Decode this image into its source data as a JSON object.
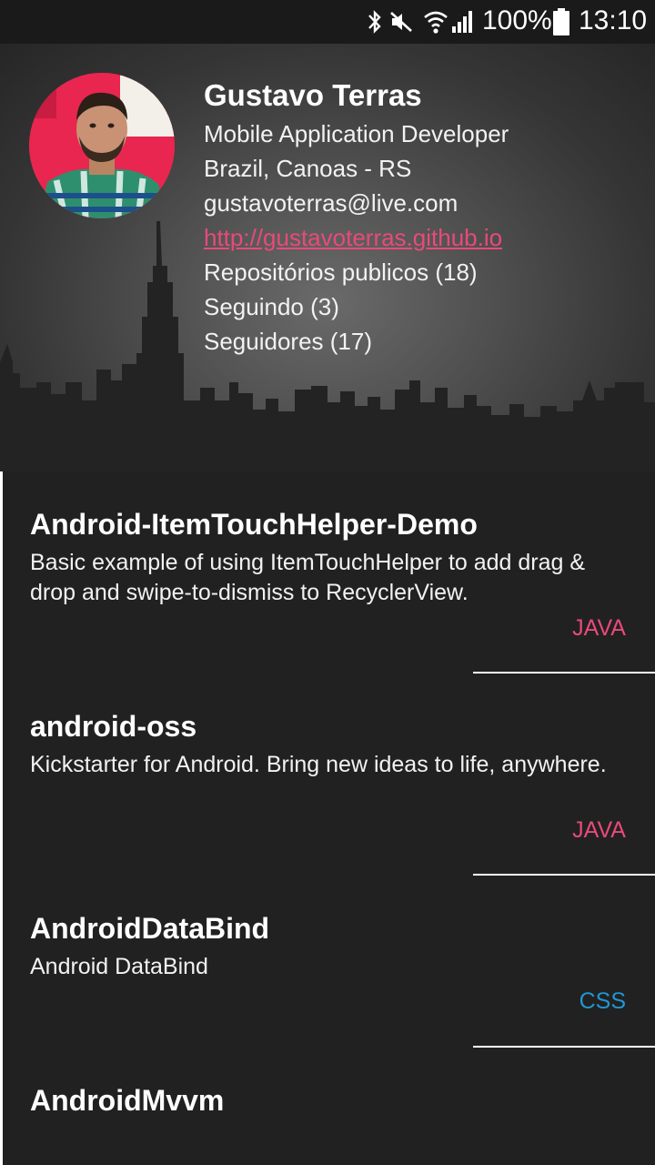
{
  "status_bar": {
    "battery": "100%",
    "time": "13:10",
    "icons": [
      "bluetooth-icon",
      "mute-icon",
      "wifi-icon",
      "signal-icon",
      "battery-icon"
    ]
  },
  "profile": {
    "name": "Gustavo Terras",
    "role": "Mobile Application Developer",
    "location": "Brazil, Canoas - RS",
    "email": "gustavoterras@live.com",
    "website": "http://gustavoterras.github.io",
    "repos": "Repositórios publicos (18)",
    "following": "Seguindo (3)",
    "followers": "Seguidores (17)"
  },
  "repositories": [
    {
      "name": "Android-ItemTouchHelper-Demo",
      "description": "Basic example of using ItemTouchHelper to add drag & drop and swipe-to-dismiss to RecyclerView.",
      "language": "JAVA",
      "language_color": "#e84a7a"
    },
    {
      "name": "android-oss",
      "description": "Kickstarter for Android. Bring new ideas to life, anywhere.",
      "language": "JAVA",
      "language_color": "#e84a7a"
    },
    {
      "name": "AndroidDataBind",
      "description": "Android DataBind",
      "language": "CSS",
      "language_color": "#2196d3"
    },
    {
      "name": "AndroidMvvm",
      "description": "",
      "language": "",
      "language_color": "#e84a7a"
    }
  ],
  "colors": {
    "background": "#212121",
    "accent": "#e84a7a",
    "css_color": "#2196d3"
  }
}
